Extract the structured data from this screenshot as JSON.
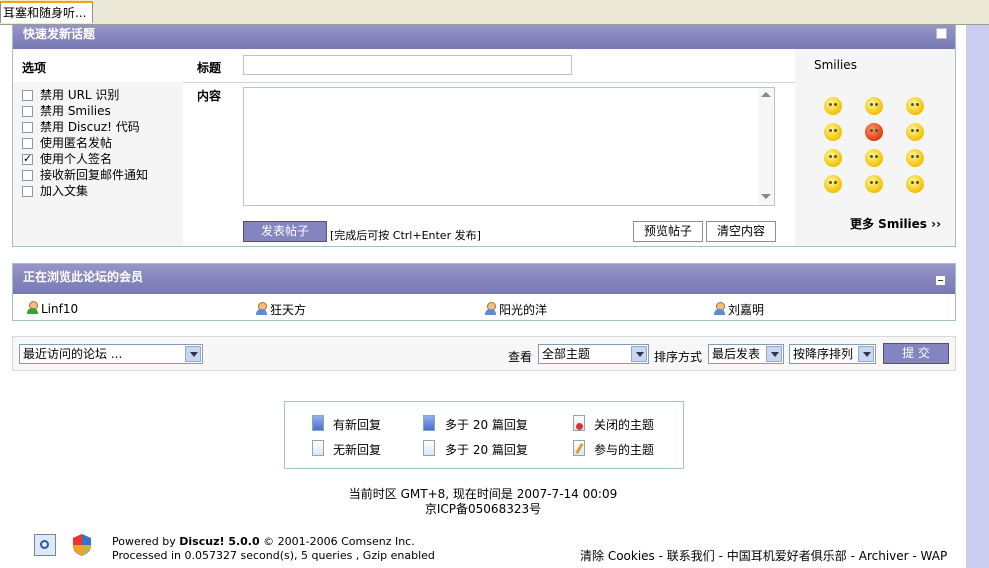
{
  "tab": {
    "title": "耳塞和随身听..."
  },
  "quickpost": {
    "header": "快速发新话题",
    "options_label": "选项",
    "subject_label": "标题",
    "content_label": "内容",
    "smilies_label": "Smilies",
    "options": [
      {
        "label": "禁用 URL 识别",
        "checked": false
      },
      {
        "label": "禁用 Smilies",
        "checked": false
      },
      {
        "label": "禁用 Discuz! 代码",
        "checked": false
      },
      {
        "label": "使用匿名发帖",
        "checked": false
      },
      {
        "label": "使用个人签名",
        "checked": true
      },
      {
        "label": "接收新回复邮件通知",
        "checked": false
      },
      {
        "label": "加入文集",
        "checked": false
      }
    ],
    "subject_value": "",
    "content_value": "",
    "submit_label": "发表帖子",
    "hint": "[完成后可按 Ctrl+Enter 发布]",
    "preview_label": "预览帖子",
    "clear_label": "清空内容",
    "more_smilies": "更多 Smilies ››"
  },
  "online": {
    "header": "正在浏览此论坛的会员",
    "users": [
      "Linf10",
      "狂天方",
      "阳光的洋",
      "刘嘉明"
    ]
  },
  "toolbar": {
    "forum_jump": "最近访问的论坛 ...",
    "view_label": "查看",
    "view_value": "全部主题",
    "sort_label": "排序方式",
    "sort_value": "最后发表",
    "order_value": "按降序排列",
    "submit_label": "提 交"
  },
  "legend": {
    "new_reply": "有新回复",
    "no_new_reply": "无新回复",
    "hot1": "多于 20 篇回复",
    "hot2": "多于 20 篇回复",
    "closed": "关闭的主题",
    "participated": "参与的主题"
  },
  "footer": {
    "timezone": "当前时区 GMT+8, 现在时间是 2007-7-14 00:09",
    "icp": "京ICP备05068323号",
    "powered_prefix": "Powered by ",
    "powered_name": "Discuz! 5.0.0",
    "copyright": "© 2001-2006 Comsenz Inc.",
    "processed": "Processed in 0.057327 second(s), 5 queries , Gzip enabled",
    "links": [
      "清除 Cookies",
      "联系我们",
      "中国耳机爱好者俱乐部",
      "Archiver",
      "WAP"
    ],
    "link_separator": " - "
  },
  "colors": {
    "header_bg": "#8484c0",
    "side_bar": "#ccccf0",
    "box_border": "#9ec3c0"
  }
}
